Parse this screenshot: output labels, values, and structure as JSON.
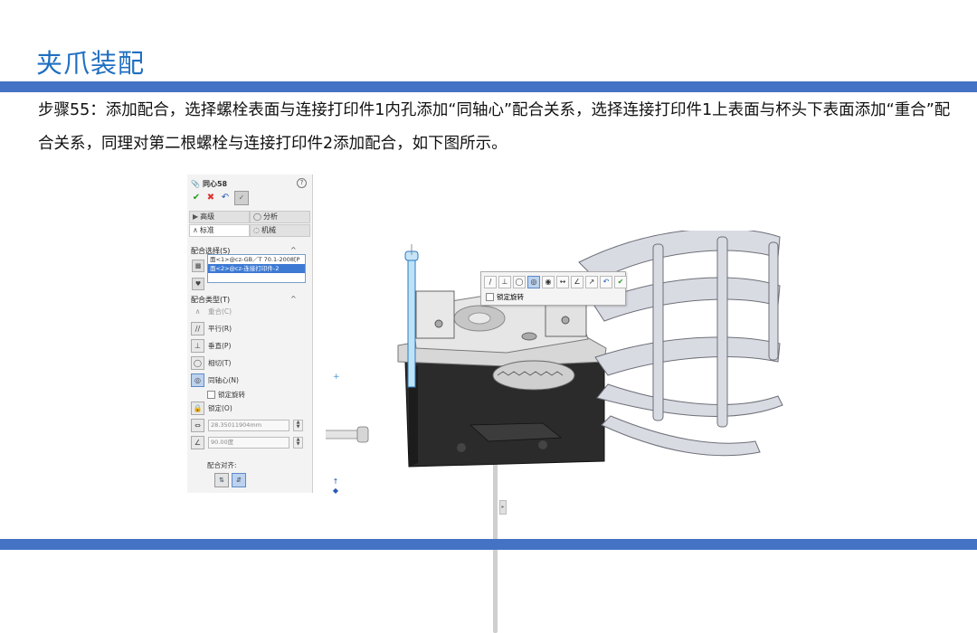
{
  "slide": {
    "title": "夹爪装配",
    "instruction": "步骤55：添加配合，选择螺栓表面与连接打印件1内孔添加“同轴心”配合关系，选择连接打印件1上表面与杯头下表面添加“重合”配合关系，同理对第二根螺栓与连接打印件2添加配合，如下图所示。",
    "accent_color": "#4472c4",
    "title_color": "#1f6fc0"
  },
  "property_manager": {
    "header_title": "同心58",
    "header_icon": "paperclip-icon",
    "help_icon": "help-icon",
    "tabs": [
      {
        "label": "高级",
        "icon": "advanced-mate-icon"
      },
      {
        "label": "分析",
        "icon": "analysis-icon"
      },
      {
        "label": "标准",
        "icon": "standard-mate-icon"
      },
      {
        "label": "机械",
        "icon": "mechanical-mate-icon"
      }
    ],
    "mate_selections": {
      "title": "配合选择(S)",
      "items": [
        "面<1>@cz-GB／T 70.1-2008[P",
        "面<2>@cz-连接打印件-2"
      ]
    },
    "mate_types": {
      "title": "配合类型(T)",
      "items": [
        {
          "label": "重合(C)",
          "icon": "coincident-icon"
        },
        {
          "label": "平行(R)",
          "icon": "parallel-icon"
        },
        {
          "label": "垂直(P)",
          "icon": "perpendicular-icon"
        },
        {
          "label": "相切(T)",
          "icon": "tangent-icon"
        },
        {
          "label": "同轴心(N)",
          "icon": "concentric-icon"
        }
      ],
      "lock_rotation_label": "锁定旋转",
      "lock_label": "锁定(O)",
      "distance_value": "28.35011904mm",
      "angle_value": "90.00度"
    },
    "mate_alignment_label": "配合对齐:"
  },
  "mate_toolbar": {
    "lock_rotation_label": "锁定旋转"
  }
}
